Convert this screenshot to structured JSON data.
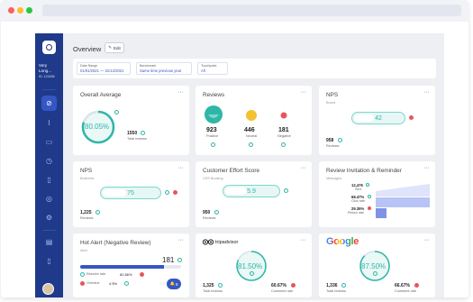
{
  "sidebar": {
    "account_name": "Very Long...",
    "account_id": "ID: 123456"
  },
  "header": {
    "title": "Overview",
    "edit_label": "Edit"
  },
  "filters": [
    {
      "label": "Date Range",
      "value": "01/01/2021 — 31/12/2021"
    },
    {
      "label": "Benchmark",
      "value": "Same time previous year"
    },
    {
      "label": "Touchpoint",
      "value": "All"
    }
  ],
  "overall_average": {
    "title": "Overall Average",
    "value": "80.05%",
    "progress": 0.8005,
    "total": "1550",
    "total_label": "Total reviews"
  },
  "reviews": {
    "title": "Reviews",
    "positive": {
      "value": "923",
      "label": "Positive"
    },
    "neutral": {
      "value": "446",
      "label": "Neutral"
    },
    "negative": {
      "value": "181",
      "label": "Negative"
    }
  },
  "nps_brand": {
    "title": "NPS",
    "subtitle": "Brand",
    "value": "42",
    "count": "958",
    "count_label": "Reviews"
  },
  "nps_business": {
    "title": "NPS",
    "subtitle": "Business",
    "value": "75",
    "count": "1,225",
    "count_label": "Reviews"
  },
  "ces": {
    "title": "Customer Effort Score",
    "subtitle": "CES Booking",
    "value": "5.9",
    "count": "950",
    "count_label": "Reviews"
  },
  "invitation": {
    "title": "Review Invitation & Reminder",
    "subtitle": "Messages",
    "rows": [
      {
        "value": "12,476",
        "label": "Sent"
      },
      {
        "value": "68.47%",
        "label": "Click rate"
      },
      {
        "value": "29.35%",
        "label": "Return rate"
      }
    ]
  },
  "hot_alert": {
    "title": "Hot Alert (Negative Review)",
    "subtitle": "Alert",
    "count": "181",
    "badge": "8",
    "resolve": {
      "label": "Resolve rate",
      "value": "82.86%",
      "fraction": 0.8286
    },
    "overdue": {
      "label": "Overdue",
      "value": "4.5%",
      "fraction": 0.045
    }
  },
  "tripadvisor": {
    "logo": "tripadvisor",
    "value": "81.50%",
    "progress": 0.815,
    "total": "1,325",
    "total_label": "Total reviews",
    "comment": "60.67%",
    "comment_label": "Comment rate"
  },
  "google": {
    "logo": "Google",
    "value": "87.50%",
    "progress": 0.875,
    "total": "1,336",
    "total_label": "Total reviews",
    "comment": "66.67%",
    "comment_label": "Comment rate"
  },
  "colors": {
    "brand": "#1f3a8a",
    "accent": "#2fb6a7",
    "negative": "#e8555d",
    "neutral": "#f2c230"
  }
}
